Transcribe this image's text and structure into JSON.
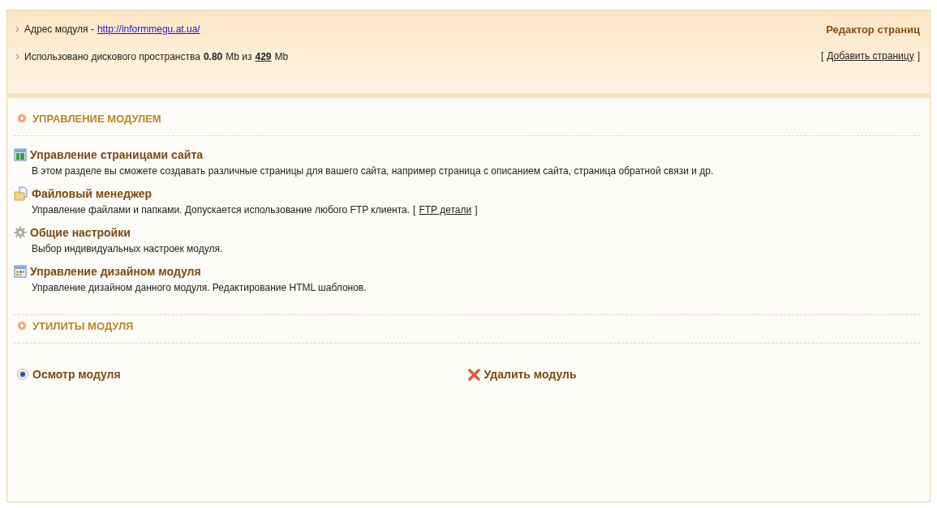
{
  "header": {
    "address_label": "Адрес модуля -",
    "address_link": "http://informmegu.at.ua/",
    "disk_label": "Использовано дискового пространства",
    "disk_used": "0.80",
    "disk_mid": "Mb из",
    "disk_total": "429",
    "disk_unit": "Mb",
    "title": "Редактор страниц",
    "action_open": "[",
    "action_label": "Добавить страницу",
    "action_close": "]"
  },
  "sections": [
    {
      "title": "УПРАВЛЕНИЕ МОДУЛЕМ",
      "kind": "list",
      "items": [
        {
          "kind": "pages",
          "title": "Управление страницами сайта",
          "description": "В этом разделе вы сможете создавать различные страницы для вашего сайта, например страница с описанием сайта, страница обратной связи и др."
        },
        {
          "kind": "files",
          "title": "Файловый менеджер",
          "description": "Управление файлами и папками. Допускается использование любого FTP клиента.",
          "link_open": "[",
          "link": "FTP детали",
          "link_close": "]"
        },
        {
          "kind": "gear",
          "title": "Общие настройки",
          "description": "Выбор индивидуальных настроек модуля."
        },
        {
          "kind": "design",
          "title": "Управление дизайном модуля",
          "description": "Управление дизайном данного модуля. Редактирование HTML шаблонов."
        }
      ]
    },
    {
      "title": "УТИЛИТЫ МОДУЛЯ",
      "kind": "row",
      "items": [
        {
          "kind": "eye",
          "title": "Осмотр модуля"
        },
        {
          "kind": "cross",
          "title": "Удалить модуль"
        }
      ]
    }
  ]
}
